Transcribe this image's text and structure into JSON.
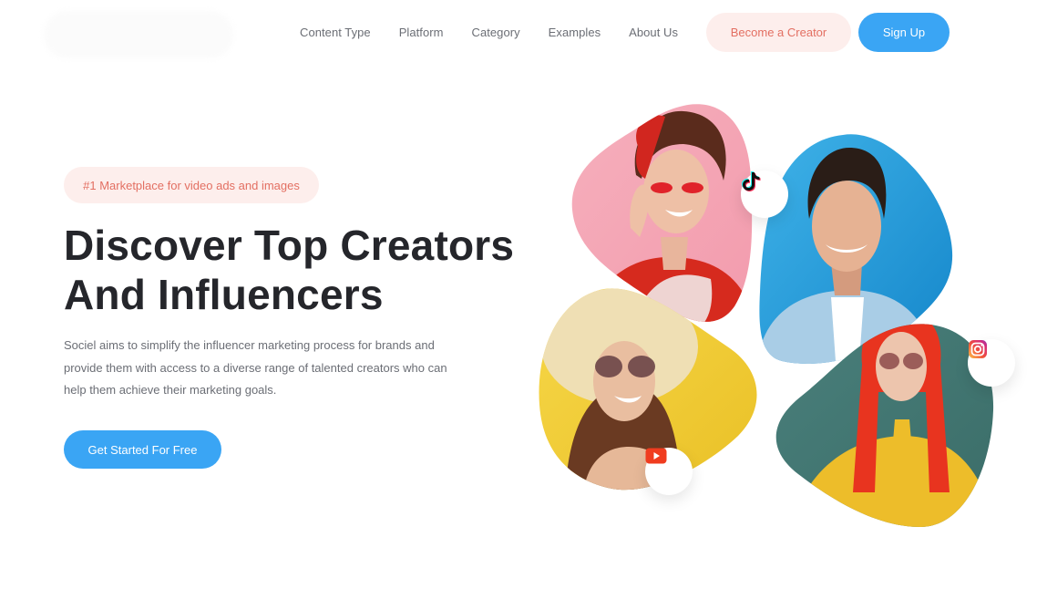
{
  "nav": {
    "logo_alt": "",
    "links": [
      {
        "label": "Content Type"
      },
      {
        "label": "Platform"
      },
      {
        "label": "Category"
      },
      {
        "label": "Examples"
      },
      {
        "label": "About Us"
      }
    ],
    "become_creator_label": "Become a Creator",
    "sign_up_label": "Sign Up"
  },
  "hero": {
    "badge": "#1 Marketplace for video ads and images",
    "title_line1": "Discover Top Creators",
    "title_line2": "And Influencers",
    "description": "Sociel aims to simplify the influencer marketing process for brands and provide them with access to a diverse range of talented creators who can help them achieve their marketing goals.",
    "cta_label": "Get Started For Free"
  },
  "collage": {
    "creators": [
      {
        "name": "creator-pink",
        "background": "#f4a7b6"
      },
      {
        "name": "creator-blue",
        "background": "#2ea6e0"
      },
      {
        "name": "creator-yellow",
        "background": "#f2cd32"
      },
      {
        "name": "creator-teal",
        "background": "#3f7772"
      }
    ],
    "platforms": [
      {
        "name": "tiktok",
        "icon": "tiktok-icon"
      },
      {
        "name": "instagram",
        "icon": "instagram-icon"
      },
      {
        "name": "youtube",
        "icon": "youtube-icon"
      }
    ]
  },
  "colors": {
    "primary": "#3aa5f4",
    "accent_soft": "#fdeeec",
    "accent_text": "#e36f62",
    "heading": "#25262b",
    "body_text": "#6b6e75"
  }
}
